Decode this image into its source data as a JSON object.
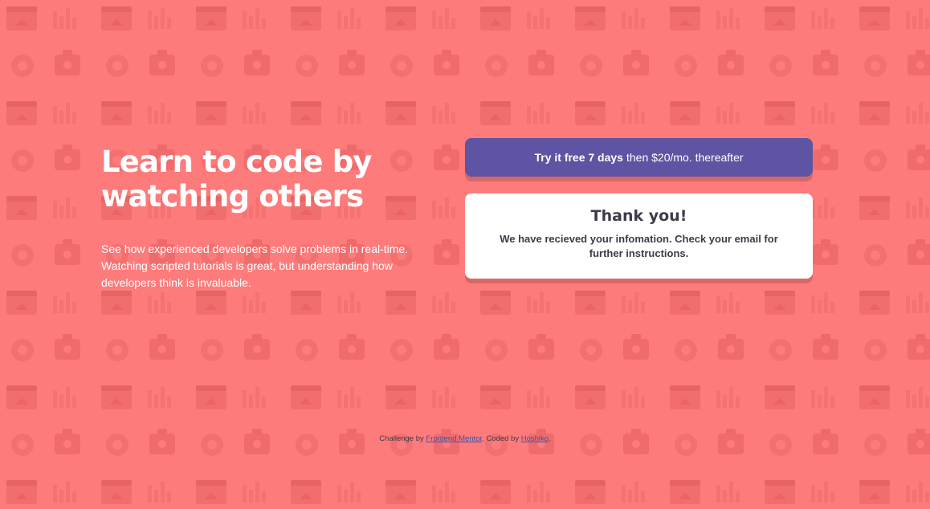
{
  "hero": {
    "title": "Learn to code by watching others",
    "text": "See how experienced developers solve problems in real-time. Watching scripted tutorials is great, but understanding how developers think is invaluable."
  },
  "promo": {
    "bold": "Try it free 7 days",
    "rest": "then $20/mo. thereafter"
  },
  "thank_you": {
    "title": "Thank you!",
    "message": "We have recieved your infomation. Check your email for further instructions."
  },
  "footer": {
    "prefix": "Challenge by ",
    "challenge_link": "Frontend Mentor",
    "middle": ". Coded by ",
    "author_link": "Hoshiko",
    "suffix": "."
  },
  "colors": {
    "background": "#fe7b7b",
    "promo": "#5e54a4",
    "card": "#ffffff",
    "text_dark": "#3d3b48"
  }
}
